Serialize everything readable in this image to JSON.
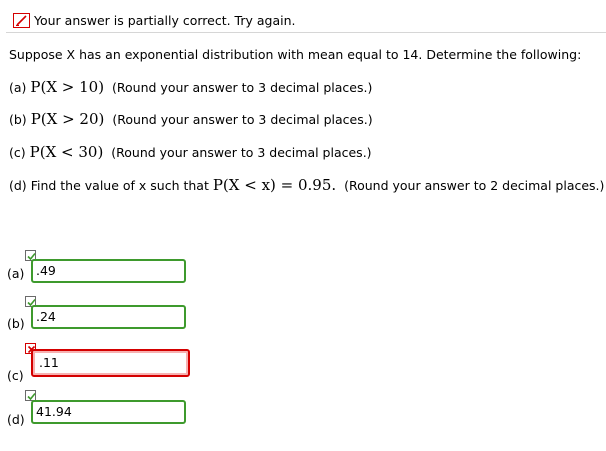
{
  "status": {
    "message": "Your answer is partially correct.  Try again."
  },
  "question": {
    "intro": "Suppose X has an exponential distribution with mean equal to 14. Determine the following:",
    "parts": [
      {
        "label": "(a)",
        "expr": "P(X > 10)",
        "instruction": "(Round your answer to 3 decimal places.)"
      },
      {
        "label": "(b)",
        "expr": "P(X > 20)",
        "instruction": "(Round your answer to 3 decimal places.)"
      },
      {
        "label": "(c)",
        "expr": "P(X < 30)",
        "instruction": "(Round your answer to 3 decimal places.)"
      },
      {
        "label": "(d)",
        "prefix": "Find the value of x such that",
        "expr": "P(X < x)  = 0.95.",
        "instruction": "(Round your answer to 2 decimal places.)"
      }
    ]
  },
  "answers": [
    {
      "label": "(a)",
      "value": ".49",
      "status": "correct"
    },
    {
      "label": "(b)",
      "value": ".24",
      "status": "correct"
    },
    {
      "label": "(c)",
      "value": ".11",
      "status": "incorrect"
    },
    {
      "label": "(d)",
      "value": "41.94",
      "status": "correct"
    }
  ],
  "colors": {
    "correct": "#3e9a2d",
    "incorrect": "#d40000"
  }
}
